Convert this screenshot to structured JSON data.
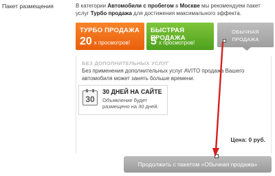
{
  "section": {
    "label": "Пакет размещения"
  },
  "intro": {
    "pre": "В категории ",
    "category": "Автомобили с пробегом",
    "mid": " в ",
    "city": "Москве",
    "mid2": " мы рекомендуем пакет услуг ",
    "pkg": "Турбо продажа",
    "post": " для достижения максимального эффекта."
  },
  "packages": [
    {
      "title": "ТУРБО ПРОДАЖА",
      "views": "20",
      "views_label": "х просмотров!",
      "color": "#f17520"
    },
    {
      "title": "БЫСТРАЯ ПРОДАЖА",
      "views": "5",
      "views_label": "х просмотров!",
      "color": "#66b22c"
    },
    {
      "title": "ОБЫЧНАЯ ПРОДАЖА",
      "line1": "ОБЫЧНАЯ",
      "line2": "ПРОДАЖА",
      "color": "#aaaaaa",
      "selected": true
    }
  ],
  "panel": {
    "title": "БЕЗ ДОПОЛНИТЕЛЬНЫХ УСЛУГ",
    "description": "Без применения дополнительных услуг AVITO продажа Вашего автомобиля может занять больше времени."
  },
  "card": {
    "icon": "calendar-icon",
    "icon_number": "30",
    "title": "30 ДНЕЙ НА САЙТЕ",
    "subtitle": "Объявление будет размещено на 30 дней."
  },
  "price": {
    "text": "Цена: 0 руб."
  },
  "continue_button": {
    "label": "Продолжить с пакетом «Обычная продажа»"
  },
  "annotation": {
    "type": "arrow",
    "color": "#d42020"
  }
}
